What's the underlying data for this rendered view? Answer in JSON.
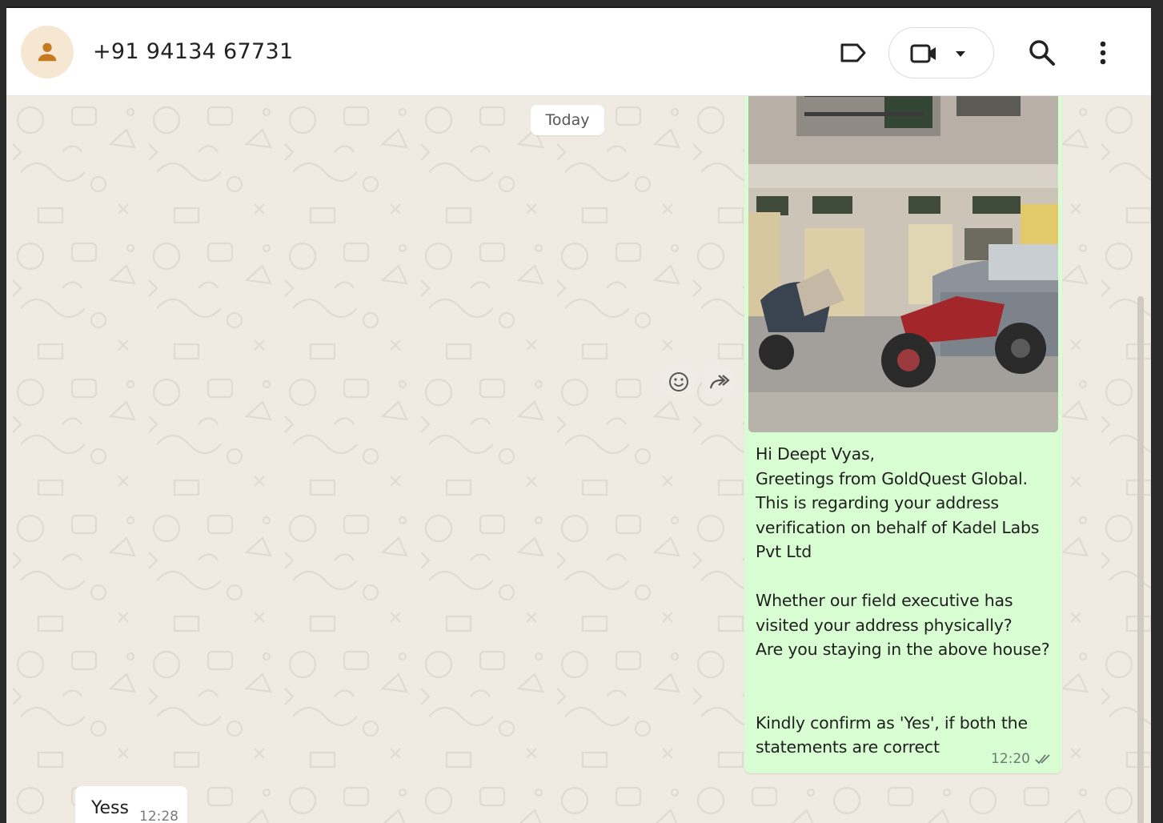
{
  "header": {
    "contact_name": "+91 94134 67731",
    "icons": [
      "person-icon",
      "label-icon",
      "video-icon",
      "chevron-down-icon",
      "search-icon",
      "more-vertical-icon"
    ]
  },
  "chat": {
    "date_separator": "Today",
    "outgoing_message": {
      "text": "Hi Deept Vyas,\nGreetings from GoldQuest Global.\nThis is regarding your address verification on behalf of Kadel Labs Pvt Ltd\n\nWhether our field executive has visited your address physically?\nAre you staying in the above house?\n\n\nKindly confirm as 'Yes', if both the statements are correct",
      "time": "12:20",
      "status": "read"
    },
    "incoming_message": {
      "text": "Yess",
      "time": "12:28"
    }
  },
  "colors": {
    "wallpaper": "#efeae2",
    "outgoing_bubble": "#d9fdd3",
    "incoming_bubble": "#ffffff",
    "header": "#ffffff"
  }
}
